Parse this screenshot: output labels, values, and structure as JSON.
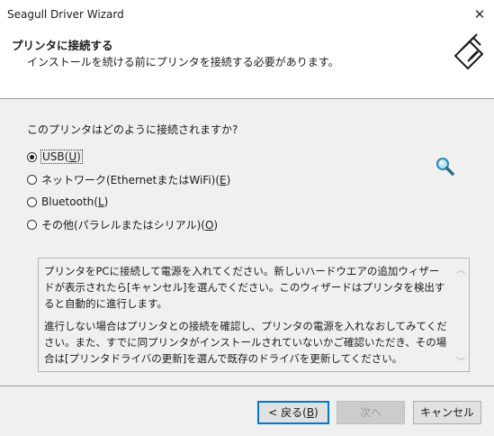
{
  "window": {
    "title": "Seagull Driver Wizard",
    "close_glyph": "✕"
  },
  "header": {
    "title": "プリンタに接続する",
    "subtitle": "インストールを続ける前にプリンタを接続する必要があります。",
    "logo_icon": "printer-wizard-icon"
  },
  "question": "このプリンタはどのように接続されますか?",
  "options": [
    {
      "label": "USB",
      "accel": "U",
      "selected": true
    },
    {
      "label": "ネットワーク(EthernetまたはWiFi)",
      "accel": "E",
      "selected": false
    },
    {
      "label": "Bluetooth",
      "accel": "L",
      "selected": false
    },
    {
      "label": "その他(パラレルまたはシリアル)",
      "accel": "O",
      "selected": false
    }
  ],
  "info": {
    "paragraph1": "プリンタをPCに接続して電源を入れてください。新しいハードウエアの追加ウィザードが表示されたら[キャンセル]を選んでください。このウィザードはプリンタを検出すると自動的に進行します。",
    "paragraph2": "進行しない場合はプリンタとの接続を確認し、プリンタの電源を入れなおしてみてください。また、すでに同プリンタがインストールされていないかご確認いただき、その場合は[プリンタドライバの更新]を選んで既存のドライバを更新してください。"
  },
  "buttons": {
    "back_label": "< 戻る(",
    "back_accel": "B",
    "back_suffix": ")",
    "next_label": "次へ",
    "cancel_label": "キャンセル"
  },
  "colors": {
    "accent": "#0078d7",
    "panel": "#f0f0f0"
  }
}
